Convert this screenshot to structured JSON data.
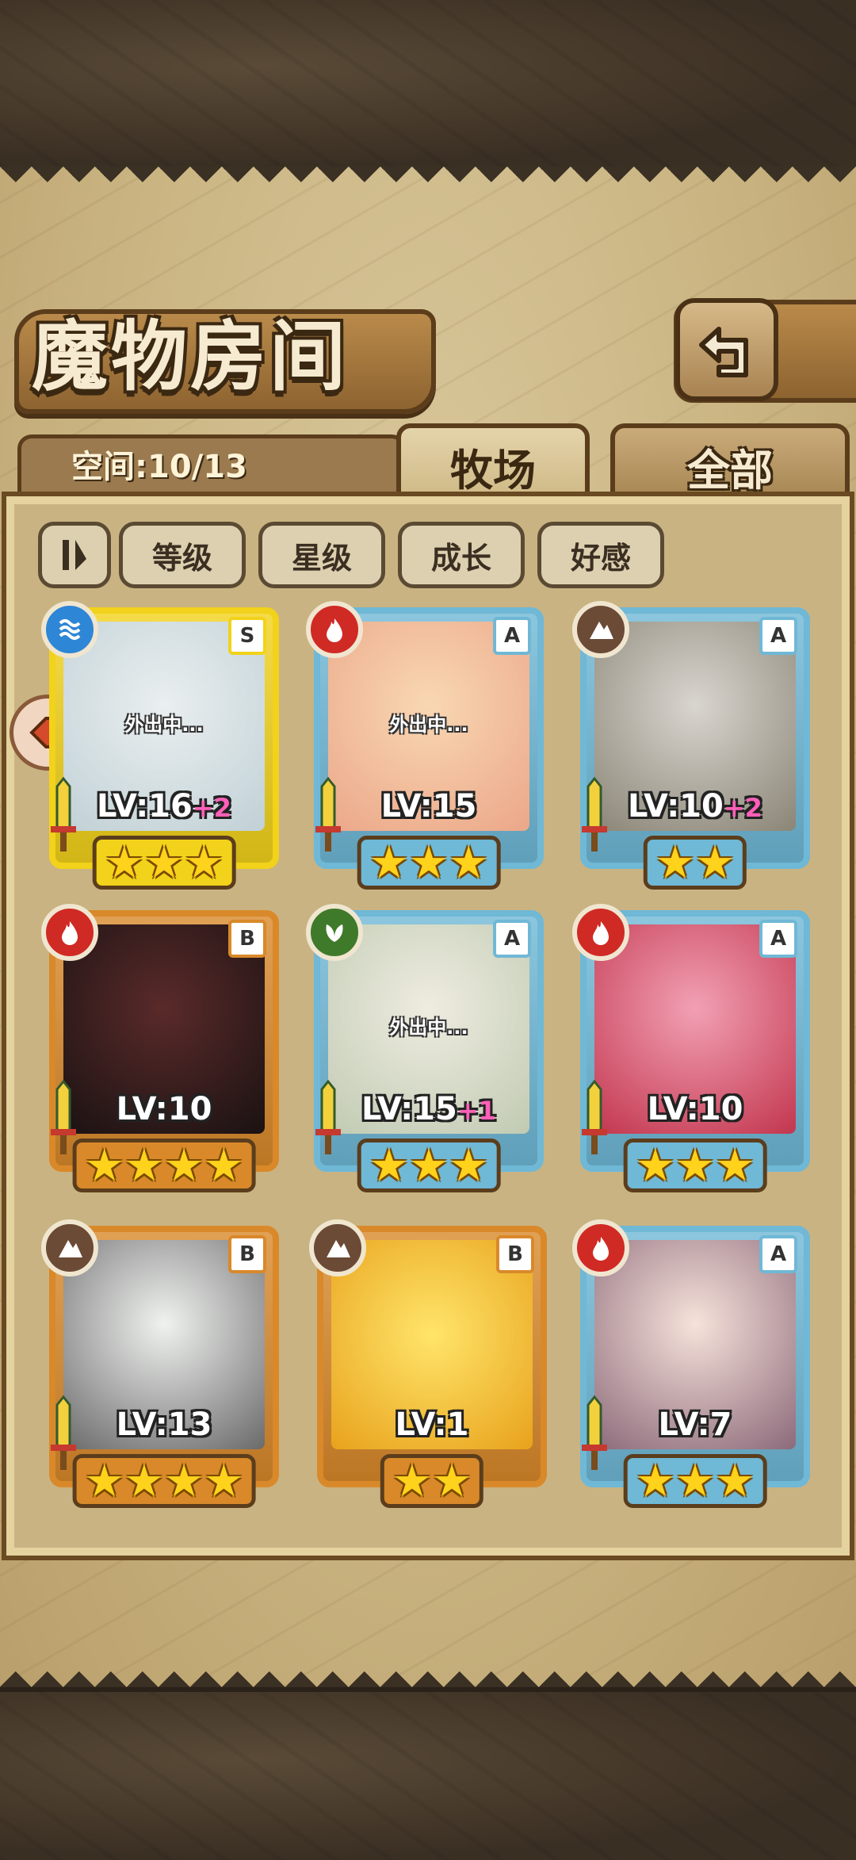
{
  "screen_title": "魔物房间",
  "space_label": "空间:10/13",
  "tabs": [
    {
      "label": "牧场",
      "active": true
    },
    {
      "label": "全部",
      "active": false
    }
  ],
  "sort_buttons": [
    "等级",
    "星级",
    "成长",
    "好感"
  ],
  "monsters": [
    {
      "element": "water",
      "rarity": "S",
      "level": "LV:16",
      "bonus": "+2",
      "stars": "★★★",
      "status": "外出中...",
      "frame": "gold"
    },
    {
      "element": "fire",
      "rarity": "A",
      "level": "LV:15",
      "bonus": "",
      "stars": "★★★",
      "status": "外出中...",
      "frame": "blue"
    },
    {
      "element": "earth",
      "rarity": "A",
      "level": "LV:10",
      "bonus": "+2",
      "stars": "★★",
      "status": "",
      "frame": "blue"
    },
    {
      "element": "fire",
      "rarity": "B",
      "level": "LV:10",
      "bonus": "",
      "stars": "★★★★",
      "status": "",
      "frame": "orange"
    },
    {
      "element": "nature",
      "rarity": "A",
      "level": "LV:15",
      "bonus": "+1",
      "stars": "★★★",
      "status": "外出中...",
      "frame": "blue"
    },
    {
      "element": "fire",
      "rarity": "A",
      "level": "LV:10",
      "bonus": "",
      "stars": "★★★",
      "status": "",
      "frame": "blue"
    },
    {
      "element": "earth",
      "rarity": "B",
      "level": "LV:13",
      "bonus": "",
      "stars": "★★★★",
      "status": "",
      "frame": "orange"
    },
    {
      "element": "earth",
      "rarity": "B",
      "level": "LV:1",
      "bonus": "",
      "stars": "★★",
      "status": "",
      "frame": "orange"
    },
    {
      "element": "fire",
      "rarity": "A",
      "level": "LV:7",
      "bonus": "",
      "stars": "★★★",
      "status": "",
      "frame": "blue"
    }
  ],
  "colors": {
    "frame_gold": "#f2d21a",
    "frame_blue": "#6fb8d6",
    "frame_orange": "#d9892a",
    "element_water": "#2e86d6",
    "element_fire": "#d02a25",
    "element_earth": "#6b4a36",
    "element_nature": "#3f7a2a"
  }
}
